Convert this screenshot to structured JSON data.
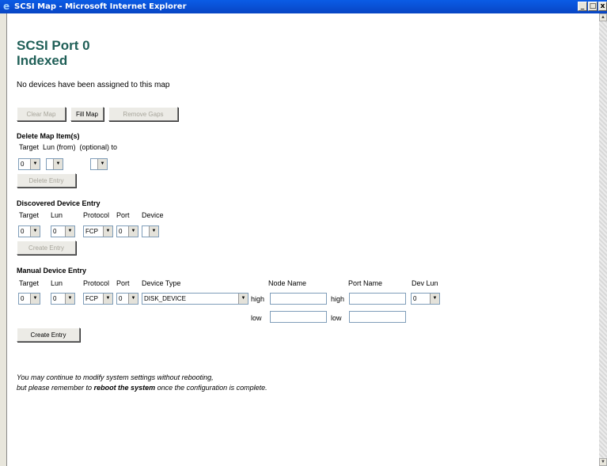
{
  "window": {
    "title": "SCSI Map - Microsoft Internet Explorer",
    "minimize_label": "_",
    "maximize_label": "□",
    "close_label": "x"
  },
  "page": {
    "title_line1": "SCSI Port 0",
    "title_line2": "Indexed",
    "status_message": "No devices have been assigned to this map"
  },
  "map_buttons": {
    "clear_map": "Clear Map",
    "fill_map": "Fill Map",
    "remove_gaps": "Remove Gaps"
  },
  "delete_map_item": {
    "section_title": "Delete Map Item(s)",
    "headers": "Target  Lun (from)  (optional) to",
    "target_value": "0",
    "lun_from_value": "",
    "lun_to_value": "",
    "delete_button": "Delete Entry"
  },
  "discovered_device": {
    "section_title": "Discovered Device Entry",
    "headers": {
      "target": "Target",
      "lun": "Lun",
      "protocol": "Protocol",
      "port": "Port",
      "device": "Device"
    },
    "target_value": "0",
    "lun_value": "0",
    "protocol_value": "FCP",
    "port_value": "0",
    "device_value": "",
    "create_button": "Create Entry"
  },
  "manual_device": {
    "section_title": "Manual Device Entry",
    "headers": {
      "target": "Target",
      "lun": "Lun",
      "protocol": "Protocol",
      "port": "Port",
      "device_type": "Device Type",
      "node_name": "Node Name",
      "port_name": "Port Name",
      "dev_lun": "Dev Lun"
    },
    "target_value": "0",
    "lun_value": "0",
    "protocol_value": "FCP",
    "port_value": "0",
    "device_type_value": "DISK_DEVICE",
    "high_label": "high",
    "low_label": "low",
    "node_name_high": "",
    "node_name_low": "",
    "port_name_high": "",
    "port_name_low": "",
    "dev_lun_value": "0",
    "create_button": "Create Entry"
  },
  "footer_note": {
    "line1": "You may continue to modify system settings without rebooting,",
    "line2_before": "but please remember to ",
    "line2_bold": "reboot the system",
    "line2_after": " once the configuration is complete."
  },
  "icons": {
    "dropdown": "▼",
    "scroll_up": "▲",
    "scroll_down": "▼",
    "ie_logo": "e"
  }
}
